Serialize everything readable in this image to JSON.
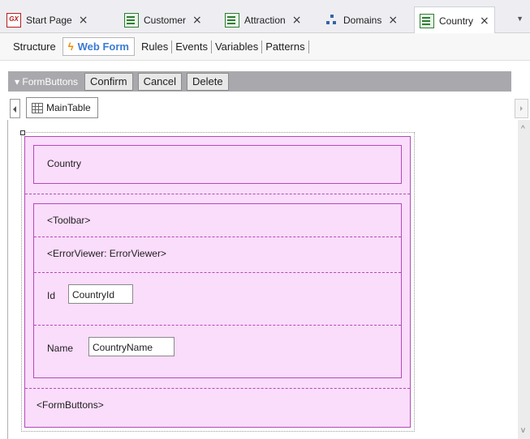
{
  "tabs": [
    {
      "label": "Start Page",
      "icon": "genexus-icon",
      "close": "×"
    },
    {
      "label": "Customer",
      "icon": "transaction-icon",
      "close": "×"
    },
    {
      "label": "Attraction",
      "icon": "transaction-icon",
      "close": "×"
    },
    {
      "label": "Domains",
      "icon": "domains-icon",
      "close": "×"
    },
    {
      "label": "Country",
      "icon": "transaction-icon",
      "close": "×",
      "active": true
    }
  ],
  "gx_icon_text": "GX",
  "dropdown_glyph": "▼",
  "subtabs": [
    "Structure",
    "Web Form",
    "Rules",
    "Events",
    "Variables",
    "Patterns"
  ],
  "form_buttons_bar": {
    "label": "▾ FormButtons",
    "buttons": [
      "Confirm",
      "Cancel",
      "Delete"
    ]
  },
  "main_table_label": "MainTable",
  "scroll": {
    "up": "^",
    "down": "v"
  },
  "form": {
    "country_title": "Country",
    "toolbar": "<Toolbar>",
    "error_viewer": "<ErrorViewer: ErrorViewer>",
    "id_label": "Id",
    "id_field": "CountryId",
    "name_label": "Name",
    "name_field": "CountryName",
    "form_buttons": "<FormButtons>"
  },
  "colors": {
    "form_background": "#fadcfb",
    "form_border": "#b34ab8",
    "active_tab_text": "#3b7bd3"
  }
}
